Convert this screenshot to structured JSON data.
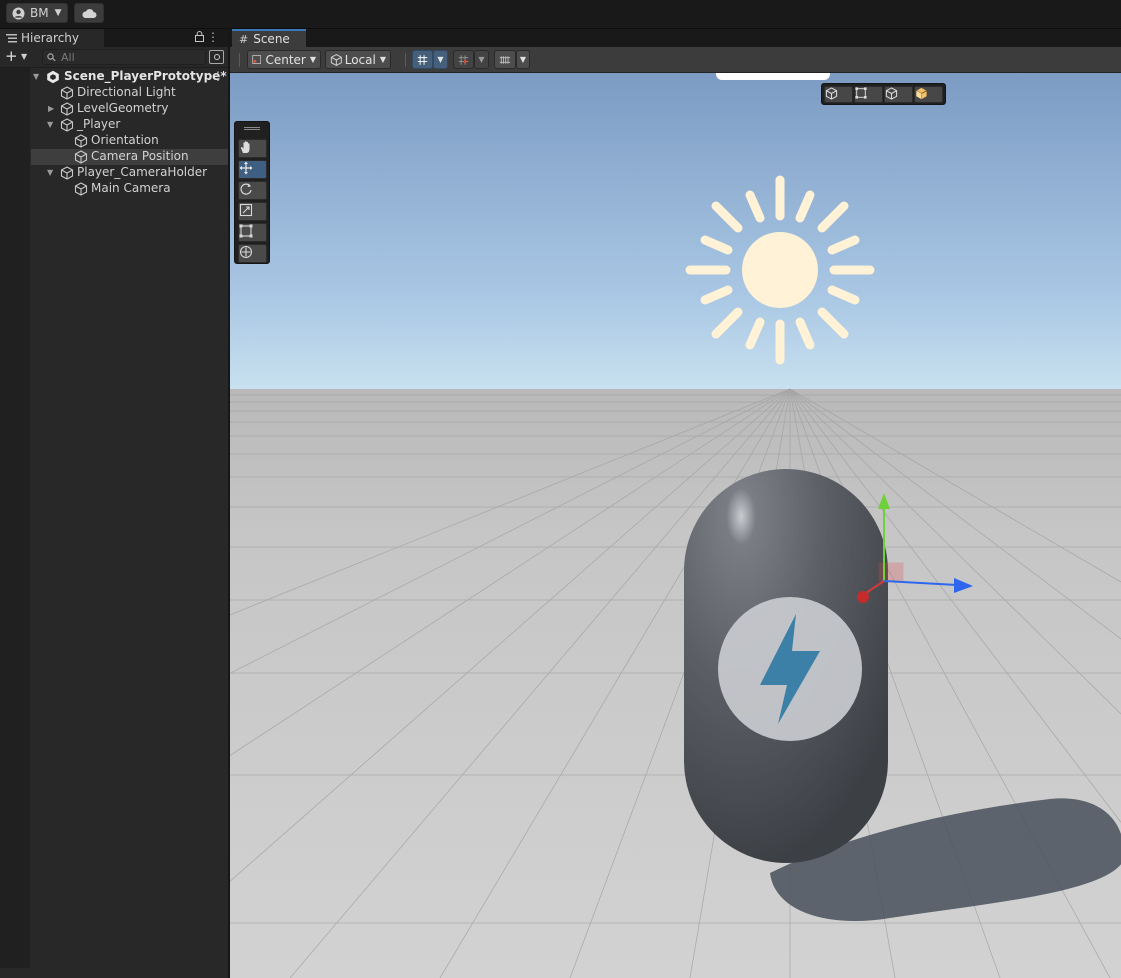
{
  "topbar": {
    "account_label": "BM",
    "account_icon": "user-circle-icon",
    "cloud_icon": "cloud-icon"
  },
  "hierarchy": {
    "tab_label": "Hierarchy",
    "search_placeholder": "All",
    "scene_name": "Scene_PlayerPrototype*",
    "items": [
      {
        "label": "Directional Light"
      },
      {
        "label": "LevelGeometry"
      },
      {
        "label": "_Player"
      },
      {
        "label": "Orientation"
      },
      {
        "label": "Camera Position"
      },
      {
        "label": "Player_CameraHolder"
      },
      {
        "label": "Main Camera"
      }
    ],
    "selected_item": "Camera Position"
  },
  "scene": {
    "tab_label": "Scene",
    "pivot_mode": "Center",
    "pivot_space": "Local"
  },
  "colors": {
    "accent": "#3a79bb",
    "selection": "#3e3e3e",
    "sky_top": "#7a9ac2",
    "sky_horizon": "#c2dcee",
    "ground": "#c9c9c9",
    "capsule": "#5e6268",
    "sun": "#fff2d6",
    "gizmo_x": "#e8363c",
    "gizmo_y": "#78d040",
    "gizmo_z": "#3a6ef2"
  }
}
